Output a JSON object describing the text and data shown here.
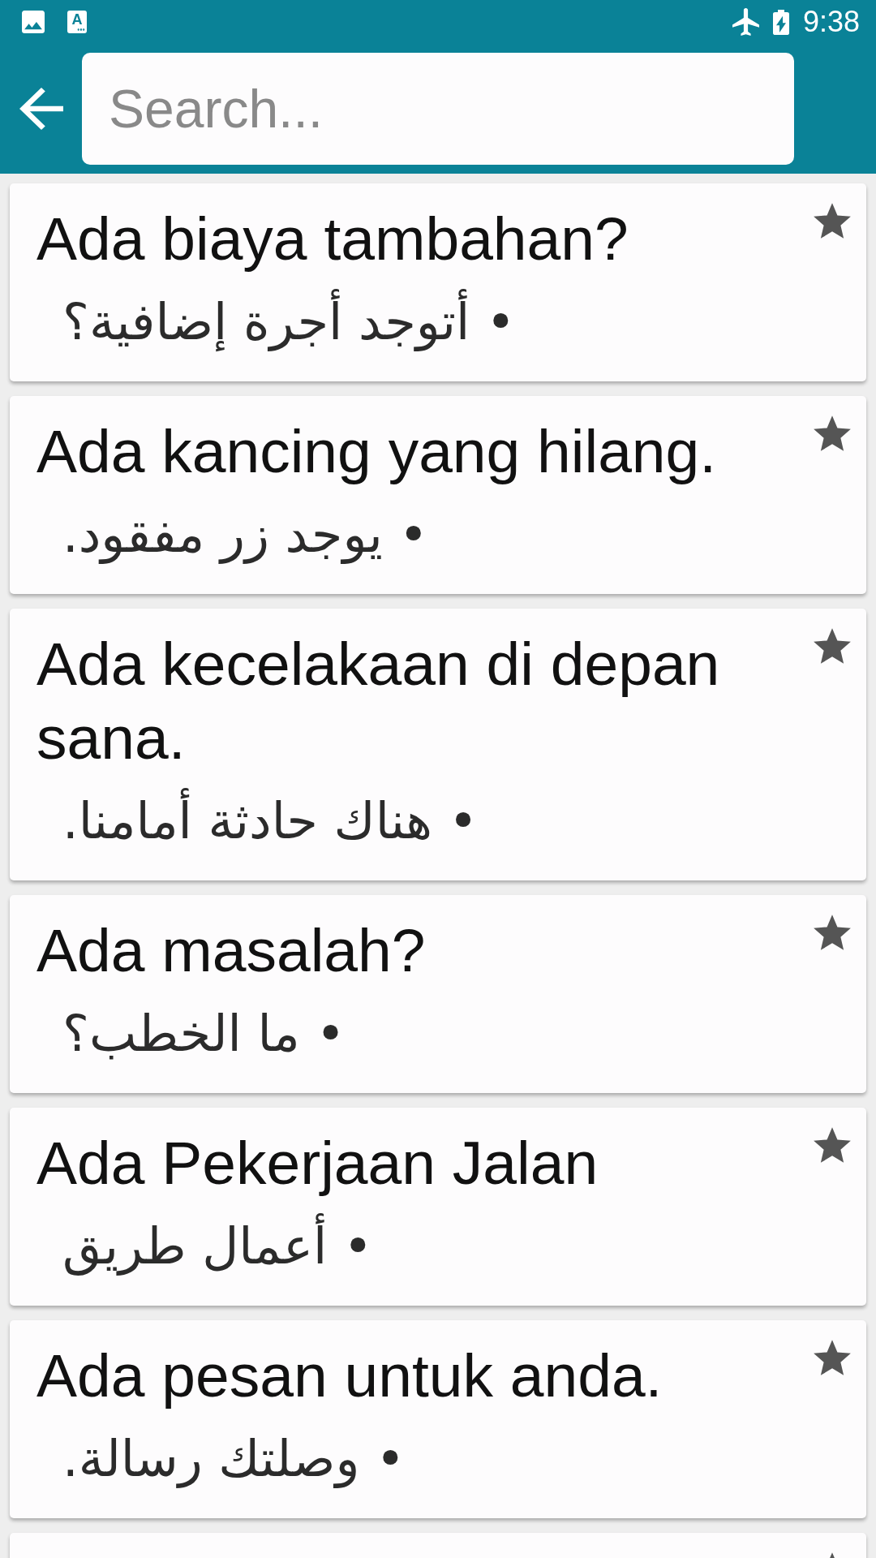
{
  "status_bar": {
    "app_icon_letter": "A",
    "airplane_mode": true,
    "battery_charging": true,
    "time": "9:38"
  },
  "toolbar": {
    "search": {
      "placeholder": "Search..."
    }
  },
  "phrases": [
    {
      "title": "Ada biaya tambahan?",
      "translation": "• أتوجد أجرة إضافية؟",
      "starred": true
    },
    {
      "title": "Ada kancing yang hilang.",
      "translation": "• يوجد زر مفقود.",
      "starred": true
    },
    {
      "title": "Ada kecelakaan di depan sana.",
      "translation": "• هناك حادثة أمامنا.",
      "starred": true
    },
    {
      "title": "Ada masalah?",
      "translation": "• ما الخطب؟",
      "starred": true
    },
    {
      "title": "Ada Pekerjaan Jalan",
      "translation": "• أعمال طريق",
      "starred": true
    },
    {
      "title": "Ada pesan untuk anda.",
      "translation": "• وصلتك رسالة.",
      "starred": true
    },
    {
      "starred": true
    }
  ]
}
